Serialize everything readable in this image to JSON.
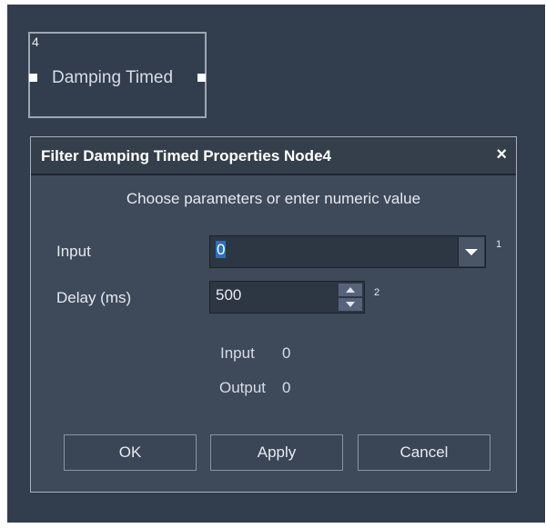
{
  "node": {
    "index": "4",
    "label": "Damping Timed"
  },
  "dialog": {
    "title": "Filter Damping Timed Properties Node4",
    "close_glyph": "×",
    "prompt": "Choose parameters or enter numeric value",
    "fields": {
      "input": {
        "label": "Input",
        "value": "0",
        "pin_number": "1"
      },
      "delay": {
        "label": "Delay (ms)",
        "value": "500",
        "pin_number": "2"
      }
    },
    "readouts": {
      "input_label": "Input",
      "input_value": "0",
      "output_label": "Output",
      "output_value": "0"
    },
    "buttons": {
      "ok": "OK",
      "apply": "Apply",
      "cancel": "Cancel"
    }
  },
  "icons": [
    "close-icon",
    "chevron-down-icon",
    "spin-up-icon",
    "spin-down-icon"
  ],
  "colors": {
    "canvas_bg": "#323d4d",
    "dialog_bg": "#3e4959",
    "selection": "#2d6fbf"
  }
}
